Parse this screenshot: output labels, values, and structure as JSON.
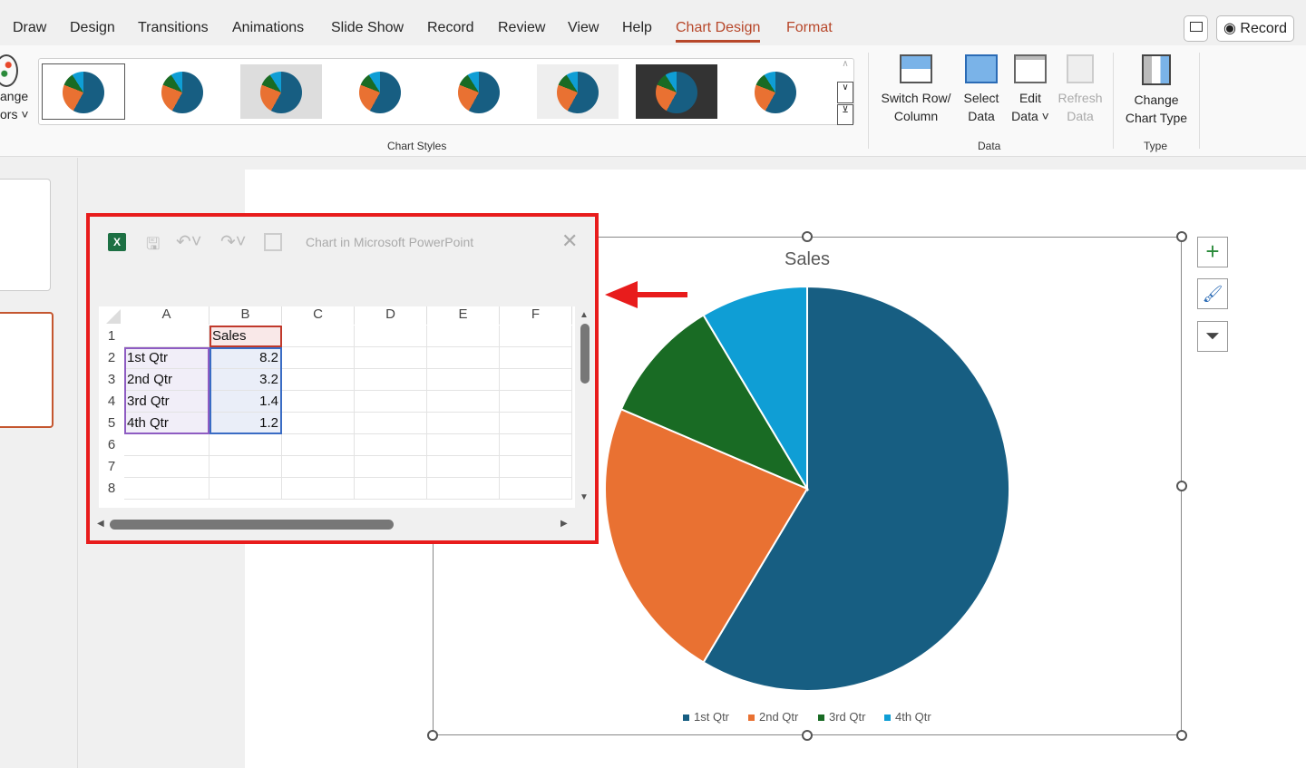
{
  "tabs": [
    "Draw",
    "Design",
    "Transitions",
    "Animations",
    "Slide Show",
    "Record",
    "Review",
    "View",
    "Help",
    "Chart Design",
    "Format"
  ],
  "active_tab": "Chart Design",
  "top_buttons": {
    "record": "Record"
  },
  "ribbon": {
    "change_colors": [
      "ange",
      "ors"
    ],
    "chart_styles_label": "Chart Styles",
    "data_group": "Data",
    "type_group": "Type",
    "switch": [
      "Switch Row/",
      "Column"
    ],
    "select": [
      "Select",
      "Data"
    ],
    "edit": [
      "Edit",
      "Data"
    ],
    "refresh": [
      "Refresh",
      "Data"
    ],
    "change_type": [
      "Change",
      "Chart Type"
    ]
  },
  "dialog": {
    "title": "Chart in Microsoft PowerPoint",
    "columns": [
      "A",
      "B",
      "C",
      "D",
      "E",
      "F"
    ],
    "rows": [
      "1",
      "2",
      "3",
      "4",
      "5",
      "6",
      "7",
      "8"
    ],
    "header_b": "Sales",
    "data": [
      [
        "1st Qtr",
        "8.2"
      ],
      [
        "2nd Qtr",
        "3.2"
      ],
      [
        "3rd Qtr",
        "1.4"
      ],
      [
        "4th Qtr",
        "1.2"
      ]
    ]
  },
  "chart_data": {
    "type": "pie",
    "title": "Sales",
    "categories": [
      "1st Qtr",
      "2nd Qtr",
      "3rd Qtr",
      "4th Qtr"
    ],
    "values": [
      8.2,
      3.2,
      1.4,
      1.2
    ],
    "colors": [
      "#175e82",
      "#e97132",
      "#196b24",
      "#0f9ed5"
    ],
    "legend": "bottom"
  },
  "colors": {
    "accent": "#b7472a",
    "highlight": "#e81c1c"
  }
}
